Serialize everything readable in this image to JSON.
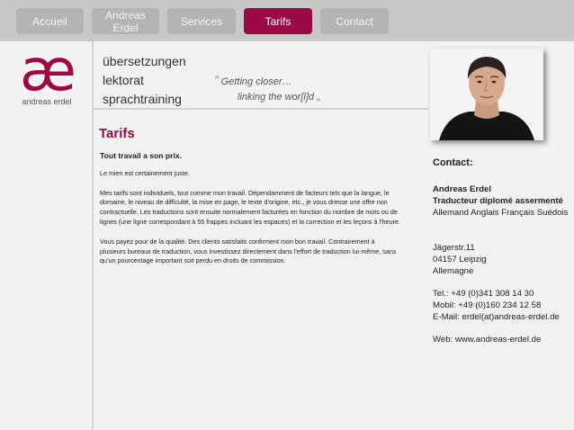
{
  "nav": {
    "items": [
      {
        "label": "Accueil",
        "active": false
      },
      {
        "label": "Andreas\nErdel",
        "active": false
      },
      {
        "label": "Services",
        "active": false
      },
      {
        "label": "Tarifs",
        "active": true
      },
      {
        "label": "Contact",
        "active": false
      }
    ],
    "active_color": "#9b0a45",
    "inactive_color": "#b4b4b4"
  },
  "logo": {
    "glyph": "æ",
    "name": "andreas erdel",
    "color": "#9b0a45"
  },
  "services": [
    "übersetzungen",
    "lektorat",
    "sprachtraining"
  ],
  "tagline": {
    "quote_open": "”",
    "line1": "Getting closer…",
    "line2": "linking the wor[l]d",
    "quote_close": "„"
  },
  "main": {
    "title": "Tarifs",
    "lead": "Tout travail a son prix.",
    "paragraphs": [
      "Le mien est certainement juste.",
      "Mes tarifs sont individuels, tout comme mon travail. Dépendamment de facteurs tels que la langue, le domaine, le niveau de difficulté, la mise en page, le texte d’origine, etc., je vous dresse une offre non contractuelle. Les traductions sont ensuite normalement facturées en fonction du nombre de mots ou de lignes (une ligne correspondant à 55 frappes incluant les espaces) et la correction et les leçons à l’heure.",
      "Vous payez pour de la qualité. Des clients satisfaits confirment mon bon travail. Contrairement à plusieurs bureaux de traduction, vous investissez directement dans l’effort de traduction lui-même, sans qu’un pourcentage important soit perdu en droits de commission."
    ]
  },
  "contact": {
    "heading": "Contact:",
    "name": "Andreas Erdel",
    "role": "Traducteur diplomé assermenté",
    "languages": "Allemand Anglais Français Suédois",
    "street": "Jägerstr.11",
    "city": "04157 Leipzig",
    "country": "Allemagne",
    "tel": "Tel.: +49 (0)341 308 14 30",
    "mobil": "Mobil: +49 (0)160 234 12 58",
    "email": "E-Mail: erdel(at)andreas-erdel.de",
    "web": "Web: www.andreas-erdel.de"
  }
}
